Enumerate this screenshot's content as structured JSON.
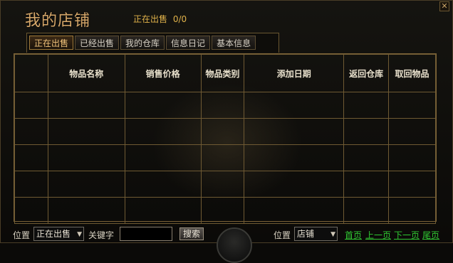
{
  "window": {
    "title": "我的店铺",
    "selling_label": "正在出售",
    "selling_count": "0/0",
    "close_glyph": "✕"
  },
  "tabs": [
    {
      "label": "正在出售",
      "active": true
    },
    {
      "label": "已经出售",
      "active": false
    },
    {
      "label": "我的仓库",
      "active": false
    },
    {
      "label": "信息日记",
      "active": false
    },
    {
      "label": "基本信息",
      "active": false
    }
  ],
  "grid": {
    "headers": [
      "",
      "物品名称",
      "销售价格",
      "物品类别",
      "添加日期",
      "返回仓库",
      "取回物品"
    ],
    "rows": [
      [
        "",
        "",
        "",
        "",
        "",
        "",
        ""
      ],
      [
        "",
        "",
        "",
        "",
        "",
        "",
        ""
      ],
      [
        "",
        "",
        "",
        "",
        "",
        "",
        ""
      ],
      [
        "",
        "",
        "",
        "",
        "",
        "",
        ""
      ],
      [
        "",
        "",
        "",
        "",
        "",
        "",
        ""
      ]
    ]
  },
  "bottom": {
    "position_label": "位置",
    "position_value": "正在出售",
    "keyword_label": "关键字",
    "keyword_value": "",
    "search_button": "搜索",
    "position2_label": "位置",
    "position2_value": "店铺",
    "first_page": "首页",
    "prev_page": "上一页",
    "next_page": "下一页",
    "last_page": "尾页"
  },
  "colors": {
    "title": "#d7a86a",
    "status": "#e0b24a",
    "page_links": "#30c832",
    "grid_lines": "#6f5a33"
  }
}
